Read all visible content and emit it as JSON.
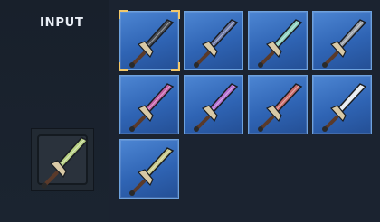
{
  "panel": {
    "title": "INPUT"
  },
  "input_slot": {
    "item_icon": "sword-green-icon",
    "blade_color": "#b9d184"
  },
  "grid": {
    "items": [
      {
        "icon": "sword-black-icon",
        "blade_color": "#4a4f57",
        "selected": true
      },
      {
        "icon": "sword-navy-icon",
        "blade_color": "#6f7aa8",
        "selected": false
      },
      {
        "icon": "sword-teal-icon",
        "blade_color": "#8ed1c0",
        "selected": false
      },
      {
        "icon": "sword-grey-icon",
        "blade_color": "#9aa0a8",
        "selected": false
      },
      {
        "icon": "sword-magenta-icon",
        "blade_color": "#c35fa6",
        "selected": false
      },
      {
        "icon": "sword-purple-icon",
        "blade_color": "#b56fd1",
        "selected": false
      },
      {
        "icon": "sword-red-icon",
        "blade_color": "#c96b6b",
        "selected": false
      },
      {
        "icon": "sword-silver-icon",
        "blade_color": "#e6ebf0",
        "selected": false
      },
      {
        "icon": "sword-olive-icon",
        "blade_color": "#c9c98a",
        "selected": false
      }
    ]
  }
}
